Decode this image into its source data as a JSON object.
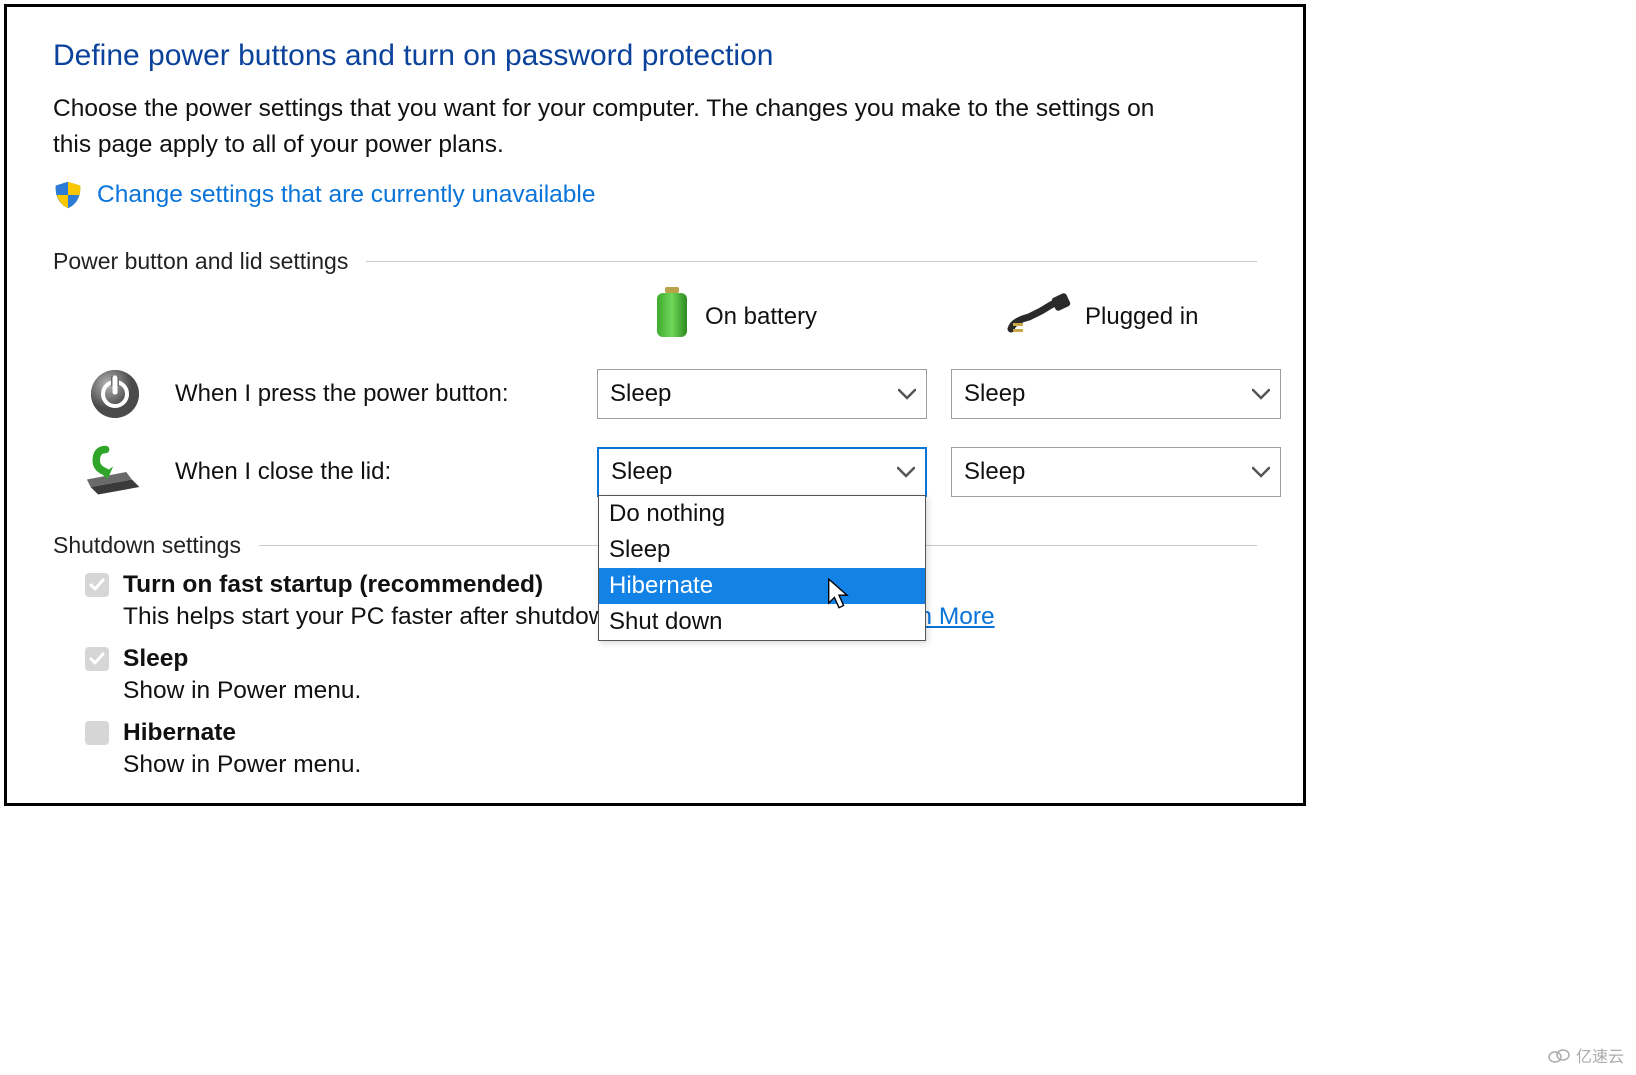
{
  "title": "Define power buttons and turn on password protection",
  "intro": "Choose the power settings that you want for your computer. The changes you make to the settings on this page apply to all of your power plans.",
  "admin_link": "Change settings that are currently unavailable",
  "sections": {
    "power_lid": "Power button and lid settings",
    "shutdown": "Shutdown settings"
  },
  "columns": {
    "battery": "On battery",
    "plugged": "Plugged in"
  },
  "rows": {
    "power_button": "When I press the power button:",
    "lid_close": "When I close the lid:"
  },
  "selections": {
    "power_button_battery": "Sleep",
    "power_button_plugged": "Sleep",
    "lid_close_battery": "Sleep",
    "lid_close_plugged": "Sleep"
  },
  "lid_battery_dropdown": {
    "open": true,
    "highlighted_index": 2,
    "options": [
      "Do nothing",
      "Sleep",
      "Hibernate",
      "Shut down"
    ]
  },
  "shutdown": {
    "fast_startup": {
      "label": "Turn on fast startup (recommended)",
      "desc_prefix": "This helps start your PC faster after shutdown. Restart isn't affected. ",
      "learn_more": "Learn More",
      "checked": true
    },
    "sleep": {
      "label": "Sleep",
      "desc": "Show in Power menu.",
      "checked": true
    },
    "hibernate": {
      "label": "Hibernate",
      "desc": "Show in Power menu.",
      "checked": false
    }
  },
  "watermark": "亿速云"
}
